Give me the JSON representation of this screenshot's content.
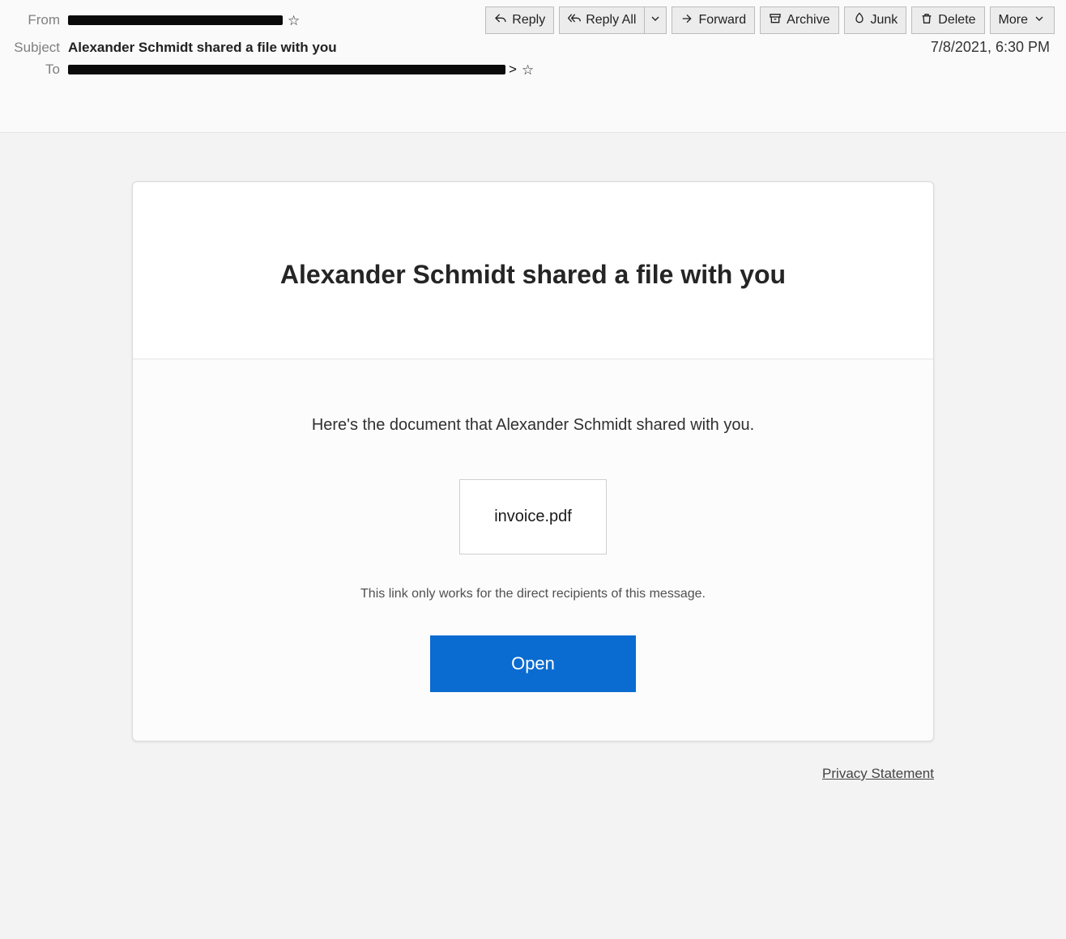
{
  "header": {
    "from_label": "From",
    "subject_label": "Subject",
    "to_label": "To",
    "subject_value": "Alexander Schmidt shared a file with you",
    "date": "7/8/2021, 6:30 PM",
    "to_suffix": ">"
  },
  "toolbar": {
    "reply": "Reply",
    "reply_all": "Reply All",
    "forward": "Forward",
    "archive": "Archive",
    "junk": "Junk",
    "delete": "Delete",
    "more": "More"
  },
  "body": {
    "title": "Alexander Schmidt shared a file with you",
    "intro": "Here's the document that Alexander Schmidt shared with you.",
    "filename": "invoice.pdf",
    "note": "This link only works for the direct recipients of this message.",
    "open": "Open",
    "privacy": "Privacy Statement"
  }
}
